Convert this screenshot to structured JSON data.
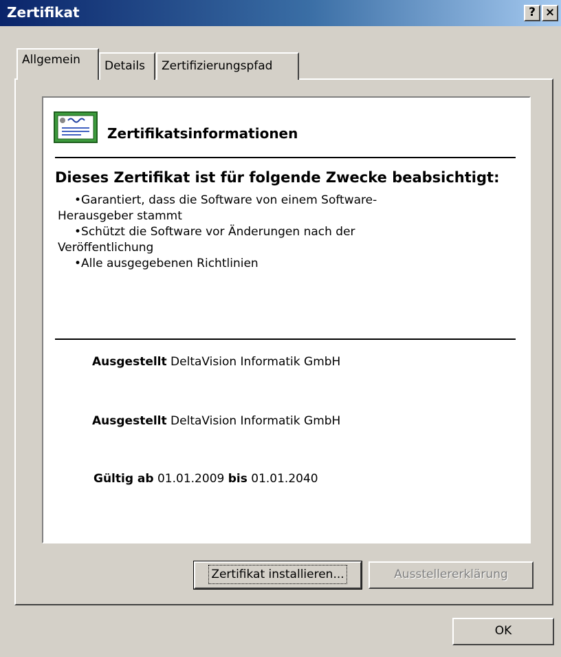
{
  "window": {
    "title": "Zertifikat",
    "help_button": "?",
    "close_button": "×"
  },
  "tabs": [
    {
      "label": "Allgemein",
      "active": true
    },
    {
      "label": "Details",
      "active": false
    },
    {
      "label": "Zertifizierungspfad",
      "active": false
    }
  ],
  "info": {
    "title": "Zertifikatsinformationen",
    "icon": "certificate-icon",
    "purpose_heading": "Dieses Zertifikat ist für folgende Zwecke beabsichtigt:",
    "purposes": [
      "•Garantiert, dass die Software von einem Software-",
      "Herausgeber stammt",
      "•Schützt die Software vor Änderungen nach der",
      "Veröffentlichung",
      "•Alle ausgegebenen Richtlinien"
    ],
    "issued_to_label": "Ausgestellt",
    "issued_to_value": "DeltaVision Informatik GmbH",
    "issued_by_label": "Ausgestellt",
    "issued_by_value": "DeltaVision Informatik GmbH",
    "valid_from_label": "Gültig ab",
    "valid_from_value": "01.01.2009",
    "valid_to_label": "bis",
    "valid_to_value": "01.01.2040"
  },
  "buttons": {
    "install": "Zertifikat installieren...",
    "issuer_statement": "Ausstellererklärung",
    "ok": "OK"
  },
  "colors": {
    "face": "#d4d0c8",
    "title_start": "#0a246a",
    "title_end": "#a6caf0",
    "disabled_text": "#808080"
  }
}
